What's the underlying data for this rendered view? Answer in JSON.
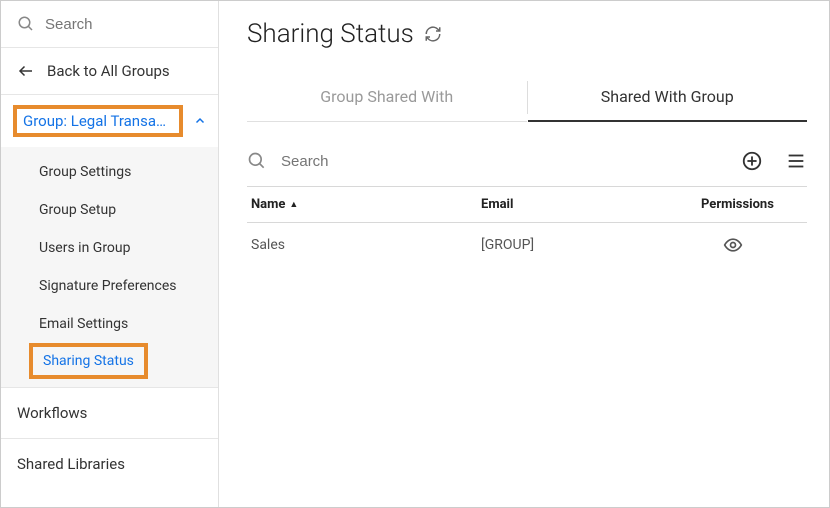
{
  "sidebar": {
    "search_placeholder": "Search",
    "back_label": "Back to All Groups",
    "group_header": "Group: Legal Transacti...",
    "items": [
      {
        "label": "Group Settings"
      },
      {
        "label": "Group Setup"
      },
      {
        "label": "Users in Group"
      },
      {
        "label": "Signature Preferences"
      },
      {
        "label": "Email Settings"
      },
      {
        "label": "Sharing Status",
        "active": true
      }
    ],
    "nav": [
      {
        "label": "Workflows"
      },
      {
        "label": "Shared Libraries"
      }
    ]
  },
  "main": {
    "title": "Sharing Status",
    "tabs": [
      {
        "label": "Group Shared With",
        "active": false
      },
      {
        "label": "Shared With Group",
        "active": true
      }
    ],
    "search_placeholder": "Search",
    "columns": {
      "name": "Name",
      "email": "Email",
      "permissions": "Permissions"
    },
    "rows": [
      {
        "name": "Sales",
        "email": "[GROUP]",
        "perm_icon": "eye-icon"
      }
    ]
  }
}
